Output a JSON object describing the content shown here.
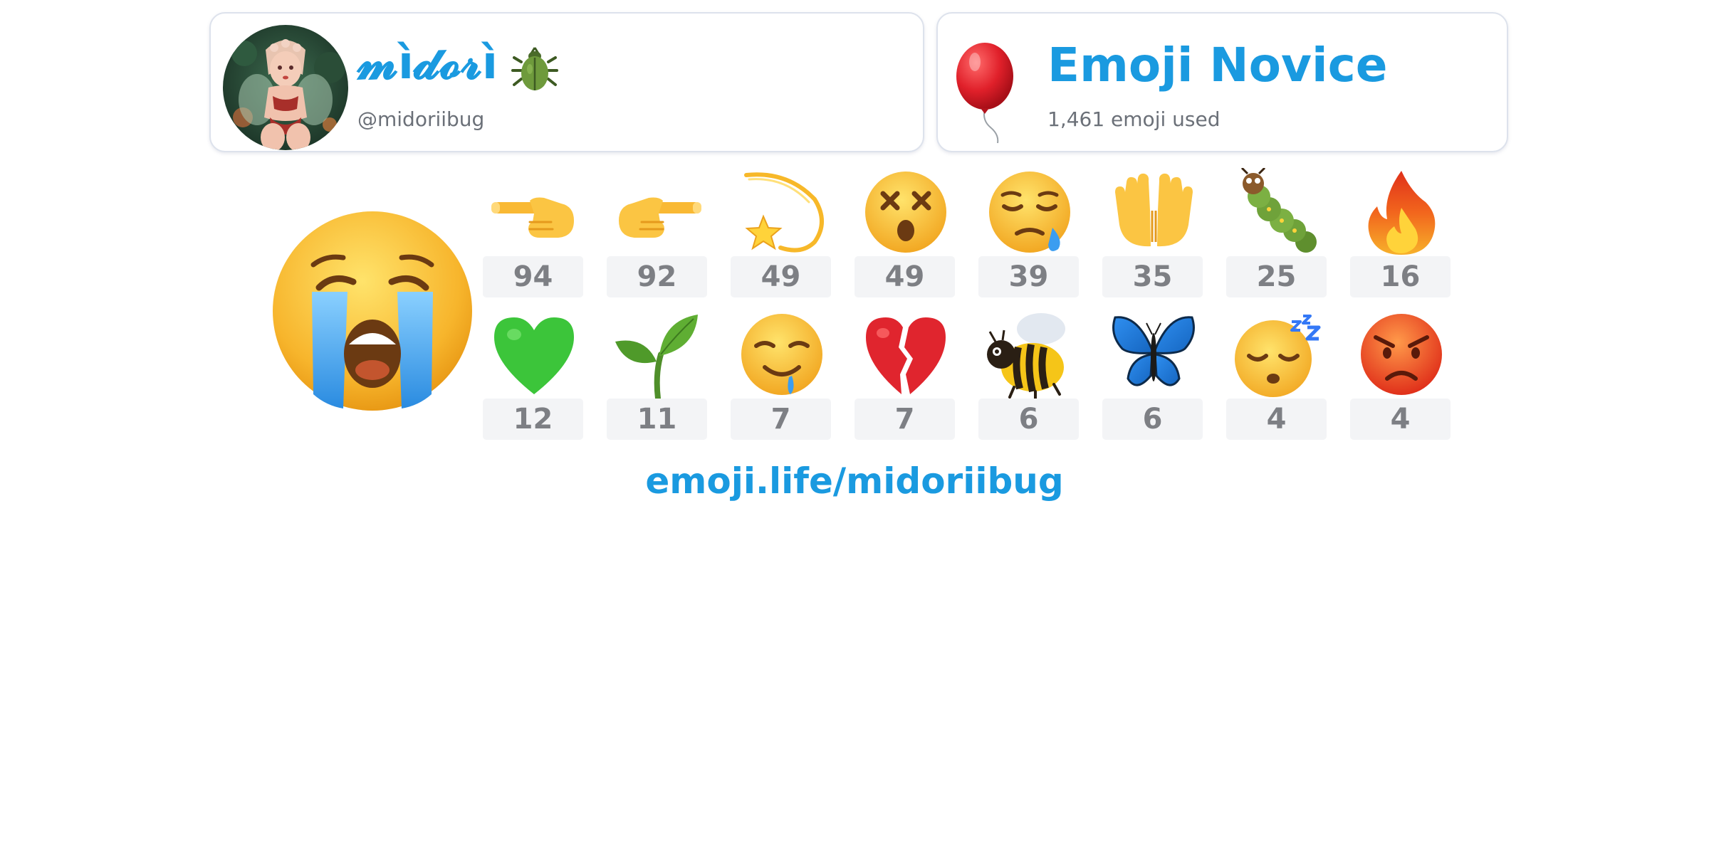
{
  "profile": {
    "display_name": "𝓶ì𝓭𝓸𝓻ì",
    "name_emoji": "beetle-icon",
    "handle": "@midoriibug",
    "avatar": "avatar-illustration"
  },
  "rank": {
    "icon": "balloon-icon",
    "title": "Emoji Novice",
    "subtitle": "1,461 emoji used"
  },
  "top_emoji": "loudly-crying-face-icon",
  "emoji_counts": [
    {
      "icon": "backhand-index-pointing-left-icon",
      "count": "94"
    },
    {
      "icon": "backhand-index-pointing-right-icon",
      "count": "92"
    },
    {
      "icon": "dizzy-icon",
      "count": "49"
    },
    {
      "icon": "dizzy-face-icon",
      "count": "49"
    },
    {
      "icon": "sleepy-face-icon",
      "count": "39"
    },
    {
      "icon": "palms-up-together-icon",
      "count": "35"
    },
    {
      "icon": "caterpillar-icon",
      "count": "25"
    },
    {
      "icon": "fire-icon",
      "count": "16"
    },
    {
      "icon": "green-heart-icon",
      "count": "12"
    },
    {
      "icon": "seedling-icon",
      "count": "11"
    },
    {
      "icon": "drooling-face-icon",
      "count": "7"
    },
    {
      "icon": "broken-heart-icon",
      "count": "7"
    },
    {
      "icon": "honeybee-icon",
      "count": "6"
    },
    {
      "icon": "butterfly-icon",
      "count": "6"
    },
    {
      "icon": "sleeping-face-icon",
      "count": "4"
    },
    {
      "icon": "angry-face-icon",
      "count": "4"
    }
  ],
  "footer": {
    "link_text": "emoji.life/midoriibug"
  },
  "colors": {
    "accent": "#1a9ae0",
    "muted_text": "#6b7078",
    "count_bg": "#f3f4f6",
    "count_text": "#7d7f84",
    "card_border": "#dde2ec"
  }
}
